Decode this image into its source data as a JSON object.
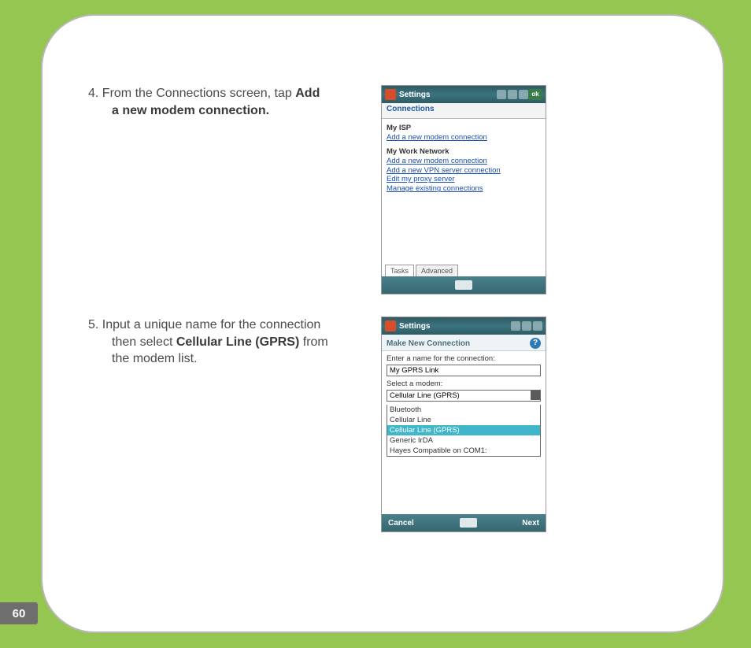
{
  "page_number": "60",
  "steps": {
    "s4": {
      "num": "4.",
      "line1": " From the Connections screen, tap ",
      "bold1": "Add",
      "line2": "a new modem connection."
    },
    "s5": {
      "num": "5.",
      "line1": " Input a unique name for the connection",
      "line2a": "then select ",
      "bold1": "Cellular Line (GPRS)",
      "line2b": " from",
      "line3": "the modem list."
    }
  },
  "shot1": {
    "title": "Settings",
    "tab_header": "Connections",
    "group1_title": "My ISP",
    "group1_link1": "Add a new modem connection",
    "group2_title": "My Work Network",
    "group2_link1": "Add a new modem connection",
    "group2_link2": "Add a new VPN server connection",
    "group2_link3": "Edit my proxy server",
    "group2_link4": "Manage existing connections",
    "tab_tasks": "Tasks",
    "tab_advanced": "Advanced"
  },
  "shot2": {
    "title": "Settings",
    "sub_header": "Make New Connection",
    "help": "?",
    "label_name": "Enter a name for the connection:",
    "input_value": "My GPRS Link",
    "label_modem": "Select a modem:",
    "combo_value": "Cellular Line (GPRS)",
    "opt1": "Bluetooth",
    "opt2": "Cellular Line",
    "opt3": "Cellular Line (GPRS)",
    "opt4": "Generic IrDA",
    "opt5": "Hayes Compatible on COM1:",
    "soft_left": "Cancel",
    "soft_right": "Next"
  }
}
